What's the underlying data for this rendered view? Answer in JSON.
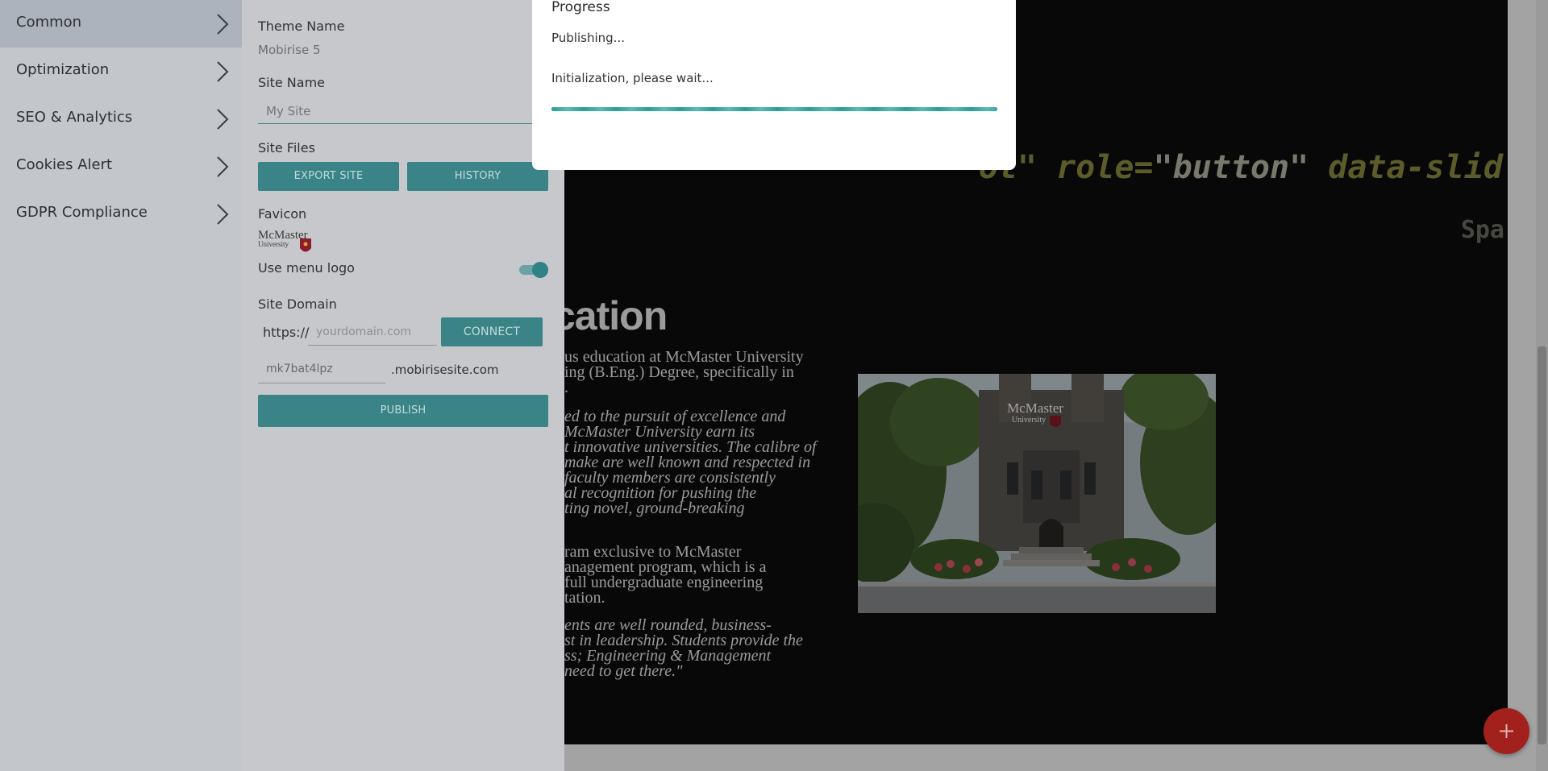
{
  "menu": {
    "items": [
      {
        "label": "Common",
        "active": true
      },
      {
        "label": "Optimization",
        "active": false
      },
      {
        "label": "SEO & Analytics",
        "active": false
      },
      {
        "label": "Cookies Alert",
        "active": false
      },
      {
        "label": "GDPR Compliance",
        "active": false
      }
    ]
  },
  "panel": {
    "theme_name_label": "Theme Name",
    "theme_name_value": "Mobirise 5",
    "site_name_label": "Site Name",
    "site_name_placeholder": "My Site",
    "site_files_label": "Site Files",
    "export_button": "EXPORT SITE",
    "history_button": "HISTORY",
    "favicon_label": "Favicon",
    "favicon_logo_line1": "McMaster",
    "favicon_logo_line2": "University",
    "use_menu_logo_label": "Use menu logo",
    "use_menu_logo_on": true,
    "site_domain_label": "Site Domain",
    "domain_prefix": "https://",
    "domain_placeholder": "yourdomain.com",
    "connect_button": "CONNECT",
    "subdomain_value": "mk7bat4lpz",
    "subdomain_suffix": ".mobirisesite.com",
    "publish_button": "PUBLISH"
  },
  "dialog": {
    "title": "Progress",
    "status": "Publishing...",
    "detail": "Initialization, please wait..."
  },
  "page": {
    "code_parts": [
      "ol\"",
      " role=",
      "\"button\"",
      " data-slid"
    ],
    "code_small": "Spa",
    "heading": "cation",
    "p1": [
      "us education at McMaster University",
      "ing (B.Eng.) Degree, specifically in",
      "."
    ],
    "p2": [
      "ed to the pursuit of excellence and",
      "McMaster University earn its",
      "t innovative universities. The calibre of",
      "make are well known and respected in",
      "faculty members are consistently",
      "al recognition for pushing the",
      "ting novel, ground-breaking"
    ],
    "p3": [
      "ram exclusive to McMaster",
      "anagement program, which is a",
      "full undergraduate engineering",
      "tation."
    ],
    "p4": [
      "ents are well rounded, business-",
      "st in leadership. Students provide the",
      "ss; Engineering & Management",
      "need to get there.\""
    ],
    "photo_logo_line1": "McMaster",
    "photo_logo_line2": "University"
  },
  "colors": {
    "accent": "#3a8386",
    "fab": "#a3211d",
    "progress": "#2e9a9a"
  },
  "icons": {
    "menu_chevron": "chevron-right-icon",
    "fab": "plus-icon"
  }
}
